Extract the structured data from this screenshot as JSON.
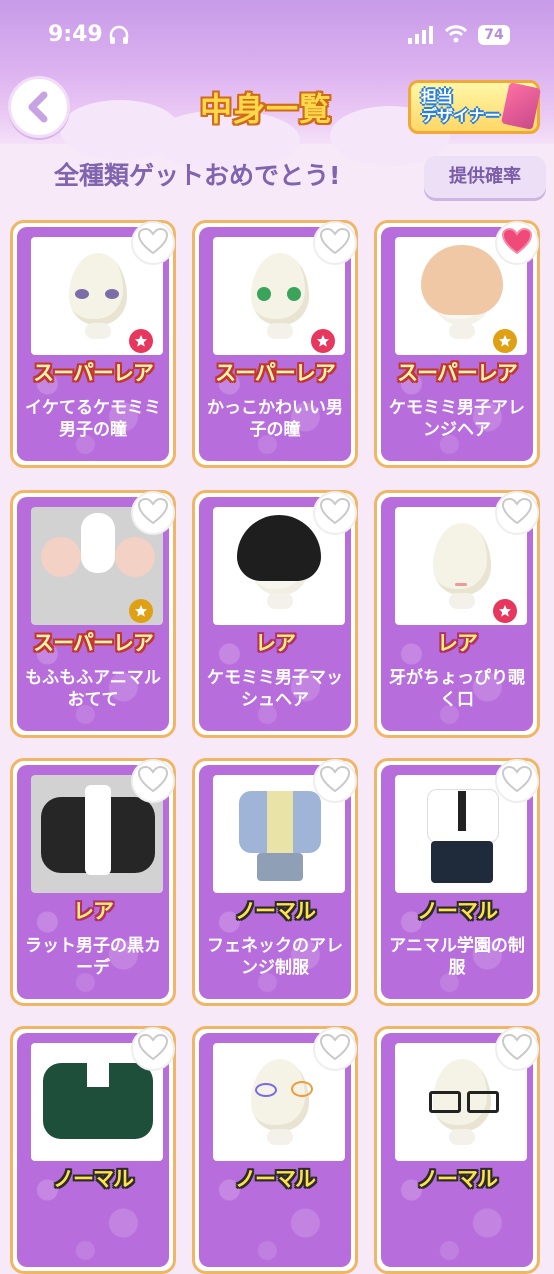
{
  "status_bar": {
    "time": "9:49",
    "battery": "74"
  },
  "header": {
    "title": "中身一覧",
    "designer_label": "担当\nデザイナー"
  },
  "subheader": {
    "message": "全種類ゲットおめでとう!",
    "rate_button": "提供確率"
  },
  "items": [
    {
      "rarity": "スーパーレア",
      "rarity_class": "super",
      "name": "イケてるケモミミ男子の瞳",
      "favorited": false,
      "thumb": "eyes-purple",
      "badge_color": "#e8375f"
    },
    {
      "rarity": "スーパーレア",
      "rarity_class": "super",
      "name": "かっこかわいい男子の瞳",
      "favorited": false,
      "thumb": "eyes-green",
      "badge_color": "#e8375f"
    },
    {
      "rarity": "スーパーレア",
      "rarity_class": "super",
      "name": "ケモミミ男子アレンジヘア",
      "favorited": true,
      "thumb": "hair-blonde",
      "badge_color": "#e0a013"
    },
    {
      "rarity": "スーパーレア",
      "rarity_class": "super",
      "name": "もふもふアニマルおてて",
      "favorited": false,
      "thumb": "paws",
      "badge_color": "#e0a013"
    },
    {
      "rarity": "レア",
      "rarity_class": "rare",
      "name": "ケモミミ男子マッシュヘア",
      "favorited": false,
      "thumb": "hair-black",
      "badge_color": ""
    },
    {
      "rarity": "レア",
      "rarity_class": "rare",
      "name": "牙がちょっぴり覗く口",
      "favorited": false,
      "thumb": "mouth",
      "badge_color": "#e8375f"
    },
    {
      "rarity": "レア",
      "rarity_class": "rare",
      "name": "ラット男子の黒カーデ",
      "favorited": false,
      "thumb": "cardigan",
      "badge_color": ""
    },
    {
      "rarity": "ノーマル",
      "rarity_class": "normal",
      "name": "フェネックのアレンジ制服",
      "favorited": false,
      "thumb": "uniform-blue",
      "badge_color": ""
    },
    {
      "rarity": "ノーマル",
      "rarity_class": "normal",
      "name": "アニマル学園の制服",
      "favorited": false,
      "thumb": "uniform-white",
      "badge_color": ""
    },
    {
      "rarity": "ノーマル",
      "rarity_class": "normal",
      "name": "",
      "favorited": false,
      "thumb": "sweater-green",
      "badge_color": ""
    },
    {
      "rarity": "ノーマル",
      "rarity_class": "normal",
      "name": "",
      "favorited": false,
      "thumb": "face-sticker",
      "badge_color": ""
    },
    {
      "rarity": "ノーマル",
      "rarity_class": "normal",
      "name": "",
      "favorited": false,
      "thumb": "glasses",
      "badge_color": ""
    }
  ],
  "colors": {
    "card_bg": "#b86ddc",
    "card_border": "#f1b665",
    "heart_on": "#f04a7a",
    "accent_text": "#8064b0"
  }
}
